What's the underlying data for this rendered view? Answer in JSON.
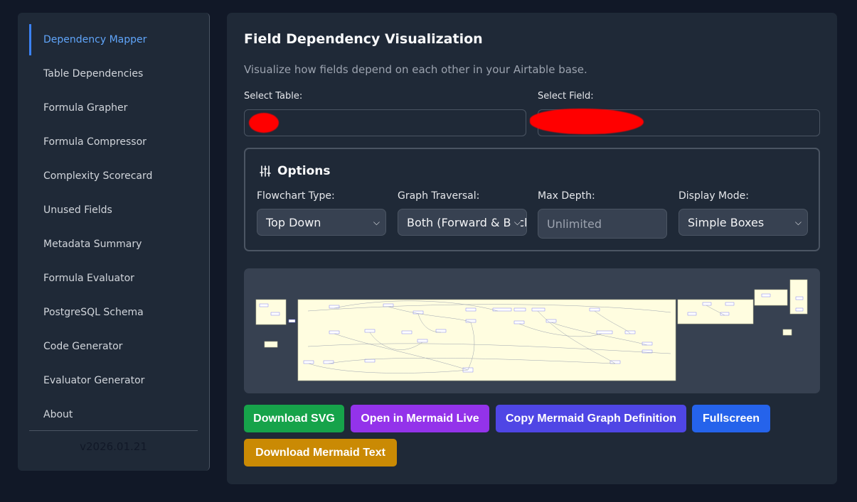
{
  "sidebar": {
    "items": [
      {
        "label": "Dependency Mapper"
      },
      {
        "label": "Table Dependencies"
      },
      {
        "label": "Formula Grapher"
      },
      {
        "label": "Formula Compressor"
      },
      {
        "label": "Complexity Scorecard"
      },
      {
        "label": "Unused Fields"
      },
      {
        "label": "Metadata Summary"
      },
      {
        "label": "Formula Evaluator"
      },
      {
        "label": "PostgreSQL Schema"
      },
      {
        "label": "Code Generator"
      },
      {
        "label": "Evaluator Generator"
      },
      {
        "label": "About"
      }
    ],
    "active_index": 0,
    "version": "v2026.01.21"
  },
  "main": {
    "title": "Field Dependency Visualization",
    "description": "Visualize how fields depend on each other in your Airtable base.",
    "select_table_label": "Select Table:",
    "select_field_label": "Select Field:",
    "options": {
      "title": "Options",
      "icon": "sliders-icon",
      "flowchart_type_label": "Flowchart Type:",
      "flowchart_type_value": "Top Down",
      "graph_traversal_label": "Graph Traversal:",
      "graph_traversal_value": "Both (Forward & Backward)",
      "max_depth_label": "Max Depth:",
      "max_depth_placeholder": "Unlimited",
      "display_mode_label": "Display Mode:",
      "display_mode_value": "Simple Boxes"
    },
    "buttons": {
      "download_svg": "Download SVG",
      "open_mermaid_live": "Open in Mermaid Live",
      "copy_mermaid": "Copy Mermaid Graph Definition",
      "fullscreen": "Fullscreen",
      "download_mermaid_text": "Download Mermaid Text"
    }
  },
  "colors": {
    "page_bg": "#111827",
    "panel_bg": "#1f2937",
    "accent": "#3b82f6",
    "download_svg_btn": "#16a34a",
    "mermaid_live_btn": "#9333ea",
    "copy_mermaid_btn": "#4f46e5",
    "fullscreen_btn": "#2563eb",
    "download_text_btn": "#ca8a04",
    "graph_bg": "#fffde0"
  }
}
